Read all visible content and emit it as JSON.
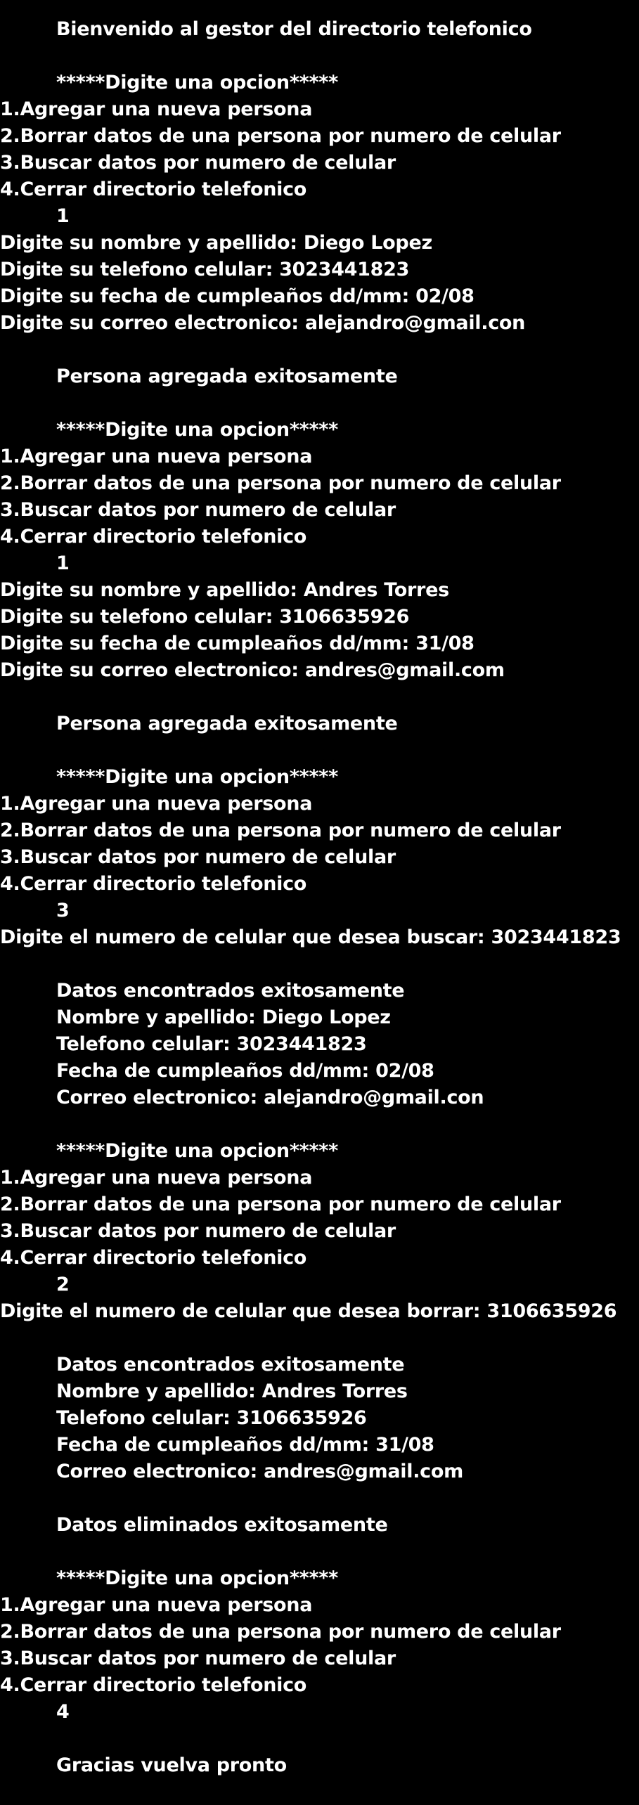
{
  "colors": {
    "background": "#000000",
    "text": "#ffffff"
  },
  "lines": [
    {
      "text": "Bienvenido al gestor del directorio telefonico",
      "indent": true
    },
    {
      "text": "*****Digite una opcion*****",
      "indent": true
    },
    {
      "text": "1.Agregar una nueva persona",
      "indent": false
    },
    {
      "text": "2.Borrar datos de una persona por numero de celular",
      "indent": false
    },
    {
      "text": "3.Buscar datos por numero de celular",
      "indent": false
    },
    {
      "text": "4.Cerrar directorio telefonico",
      "indent": false
    },
    {
      "text": "1",
      "indent": true
    },
    {
      "text": "Digite su nombre y apellido: Diego Lopez",
      "indent": false
    },
    {
      "text": "Digite su telefono celular: 3023441823",
      "indent": false
    },
    {
      "text": "Digite su fecha de cumpleaños dd/mm: 02/08",
      "indent": false
    },
    {
      "text": "Digite su correo electronico: alejandro@gmail.con",
      "indent": false
    },
    {
      "text": "Persona agregada exitosamente",
      "indent": true
    },
    {
      "text": "*****Digite una opcion*****",
      "indent": true
    },
    {
      "text": "1.Agregar una nueva persona",
      "indent": false
    },
    {
      "text": "2.Borrar datos de una persona por numero de celular",
      "indent": false
    },
    {
      "text": "3.Buscar datos por numero de celular",
      "indent": false
    },
    {
      "text": "4.Cerrar directorio telefonico",
      "indent": false
    },
    {
      "text": "1",
      "indent": true
    },
    {
      "text": "Digite su nombre y apellido: Andres Torres",
      "indent": false
    },
    {
      "text": "Digite su telefono celular: 3106635926",
      "indent": false
    },
    {
      "text": "Digite su fecha de cumpleaños dd/mm: 31/08",
      "indent": false
    },
    {
      "text": "Digite su correo electronico: andres@gmail.com",
      "indent": false
    },
    {
      "text": "Persona agregada exitosamente",
      "indent": true
    },
    {
      "text": "*****Digite una opcion*****",
      "indent": true
    },
    {
      "text": "1.Agregar una nueva persona",
      "indent": false
    },
    {
      "text": "2.Borrar datos de una persona por numero de celular",
      "indent": false
    },
    {
      "text": "3.Buscar datos por numero de celular",
      "indent": false
    },
    {
      "text": "4.Cerrar directorio telefonico",
      "indent": false
    },
    {
      "text": "3",
      "indent": true
    },
    {
      "text": "Digite el numero de celular que desea buscar: 3023441823",
      "indent": false
    },
    {
      "text": "Datos encontrados exitosamente",
      "indent": true
    },
    {
      "text": "Nombre y apellido: Diego Lopez",
      "indent": true
    },
    {
      "text": "Telefono celular: 3023441823",
      "indent": true
    },
    {
      "text": "Fecha de cumpleaños dd/mm: 02/08",
      "indent": true
    },
    {
      "text": "Correo electronico: alejandro@gmail.con",
      "indent": true
    },
    {
      "text": "*****Digite una opcion*****",
      "indent": true
    },
    {
      "text": "1.Agregar una nueva persona",
      "indent": false
    },
    {
      "text": "2.Borrar datos de una persona por numero de celular",
      "indent": false
    },
    {
      "text": "3.Buscar datos por numero de celular",
      "indent": false
    },
    {
      "text": "4.Cerrar directorio telefonico",
      "indent": false
    },
    {
      "text": "2",
      "indent": true
    },
    {
      "text": "Digite el numero de celular que desea borrar: 3106635926",
      "indent": false
    },
    {
      "text": "Datos encontrados exitosamente",
      "indent": true
    },
    {
      "text": "Nombre y apellido: Andres Torres",
      "indent": true
    },
    {
      "text": "Telefono celular: 3106635926",
      "indent": true
    },
    {
      "text": "Fecha de cumpleaños dd/mm: 31/08",
      "indent": true
    },
    {
      "text": "Correo electronico: andres@gmail.com",
      "indent": true
    },
    {
      "text": "Datos eliminados exitosamente",
      "indent": true
    },
    {
      "text": "*****Digite una opcion*****",
      "indent": true
    },
    {
      "text": "1.Agregar una nueva persona",
      "indent": false
    },
    {
      "text": "2.Borrar datos de una persona por numero de celular",
      "indent": false
    },
    {
      "text": "3.Buscar datos por numero de celular",
      "indent": false
    },
    {
      "text": "4.Cerrar directorio telefonico",
      "indent": false
    },
    {
      "text": "4",
      "indent": true
    },
    {
      "text": "Gracias vuelva pronto",
      "indent": true
    }
  ]
}
